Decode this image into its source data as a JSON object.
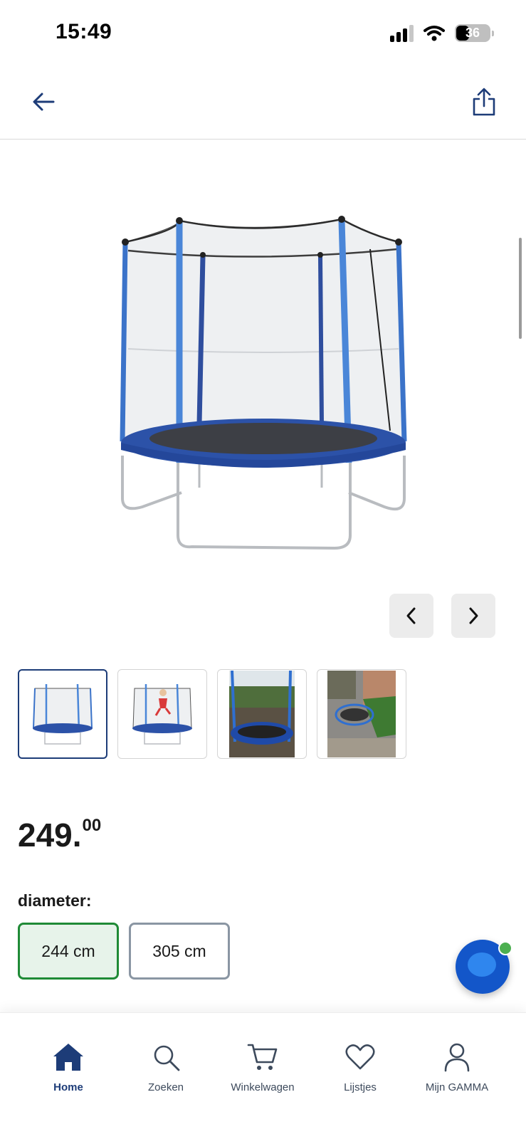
{
  "status_bar": {
    "time": "15:49",
    "battery": "36",
    "icons": [
      "signal-icon",
      "wifi-icon",
      "battery-icon"
    ]
  },
  "nav_bar": {
    "back_icon": "arrow-left-icon",
    "share_icon": "share-icon"
  },
  "gallery": {
    "prev_icon": "chevron-left-icon",
    "next_icon": "chevron-right-icon",
    "selected_thumbnail_index": 0,
    "thumbnail_count": 4
  },
  "product": {
    "price_main": "249.",
    "price_cents": "00"
  },
  "variant": {
    "label": "diameter:",
    "options": [
      {
        "label": "244 cm",
        "selected": true
      },
      {
        "label": "305 cm",
        "selected": false
      }
    ]
  },
  "tab_bar": {
    "tabs": [
      {
        "label": "Home",
        "icon": "home-icon",
        "active": true
      },
      {
        "label": "Zoeken",
        "icon": "search-icon",
        "active": false
      },
      {
        "label": "Winkelwagen",
        "icon": "cart-icon",
        "active": false
      },
      {
        "label": "Lijstjes",
        "icon": "heart-icon",
        "active": false
      },
      {
        "label": "Mijn GAMMA",
        "icon": "user-icon",
        "active": false
      }
    ]
  },
  "colors": {
    "brand_blue": "#1d3c78",
    "selected_green": "#1f8a36",
    "selected_fill": "#e7f3ea",
    "chat_blue": "#1356c9"
  }
}
